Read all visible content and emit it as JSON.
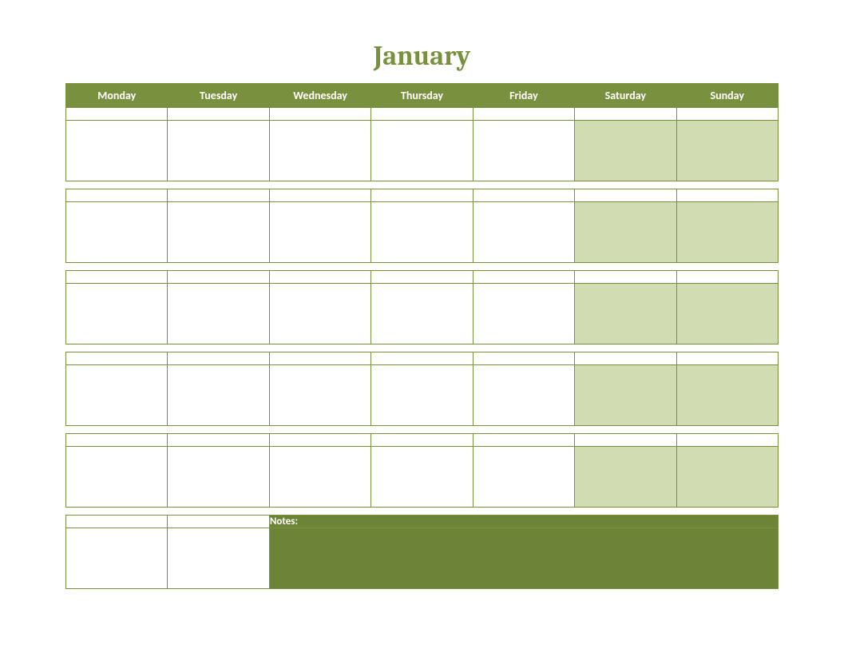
{
  "title": "January",
  "days": [
    "Monday",
    "Tuesday",
    "Wednesday",
    "Thursday",
    "Friday",
    "Saturday",
    "Sunday"
  ],
  "notes_label": "Notes:",
  "colors": {
    "header_bg": "#79913f",
    "header_text": "#ffffff",
    "weekend_bg": "#d2dcb3",
    "notes_bg": "#6c8338",
    "border": "#79913f",
    "title": "#79913f"
  },
  "weeks": [
    {
      "has_notes": false
    },
    {
      "has_notes": false
    },
    {
      "has_notes": false
    },
    {
      "has_notes": false
    },
    {
      "has_notes": false
    },
    {
      "has_notes": true,
      "weekday_cells": 2
    }
  ]
}
